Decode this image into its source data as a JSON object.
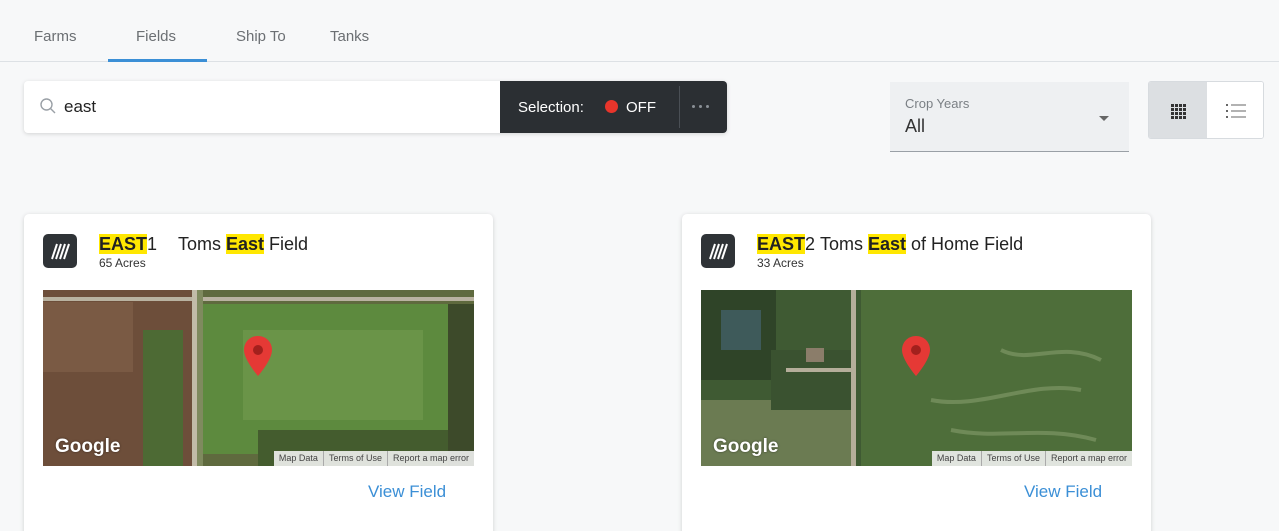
{
  "tabs": [
    {
      "label": "Farms"
    },
    {
      "label": "Fields",
      "active": true
    },
    {
      "label": "Ship To"
    },
    {
      "label": "Tanks"
    }
  ],
  "search": {
    "value": "east",
    "icon": "search-icon"
  },
  "selection": {
    "label": "Selection:",
    "state": "OFF",
    "state_color": "#e8352b"
  },
  "crop_years": {
    "label": "Crop Years",
    "value": "All"
  },
  "view_toggle": {
    "active": "grid"
  },
  "map_attribution": [
    "Map Data",
    "Terms of Use",
    "Report a map error"
  ],
  "map_logo": "Google",
  "cards": [
    {
      "id_highlight": "EAST",
      "id_rest": "1",
      "acres": "65 Acres",
      "name_before": "Toms ",
      "name_highlight": "East",
      "name_after": " Field",
      "link": "View Field"
    },
    {
      "id_highlight": "EAST",
      "id_rest": "2",
      "acres": "33 Acres",
      "name_before": "Toms ",
      "name_highlight": "East",
      "name_after": " of Home Field",
      "link": "View Field"
    }
  ],
  "colors": {
    "accent": "#3b8fd6",
    "highlight": "#ffe700",
    "dark": "#2b2f33"
  }
}
